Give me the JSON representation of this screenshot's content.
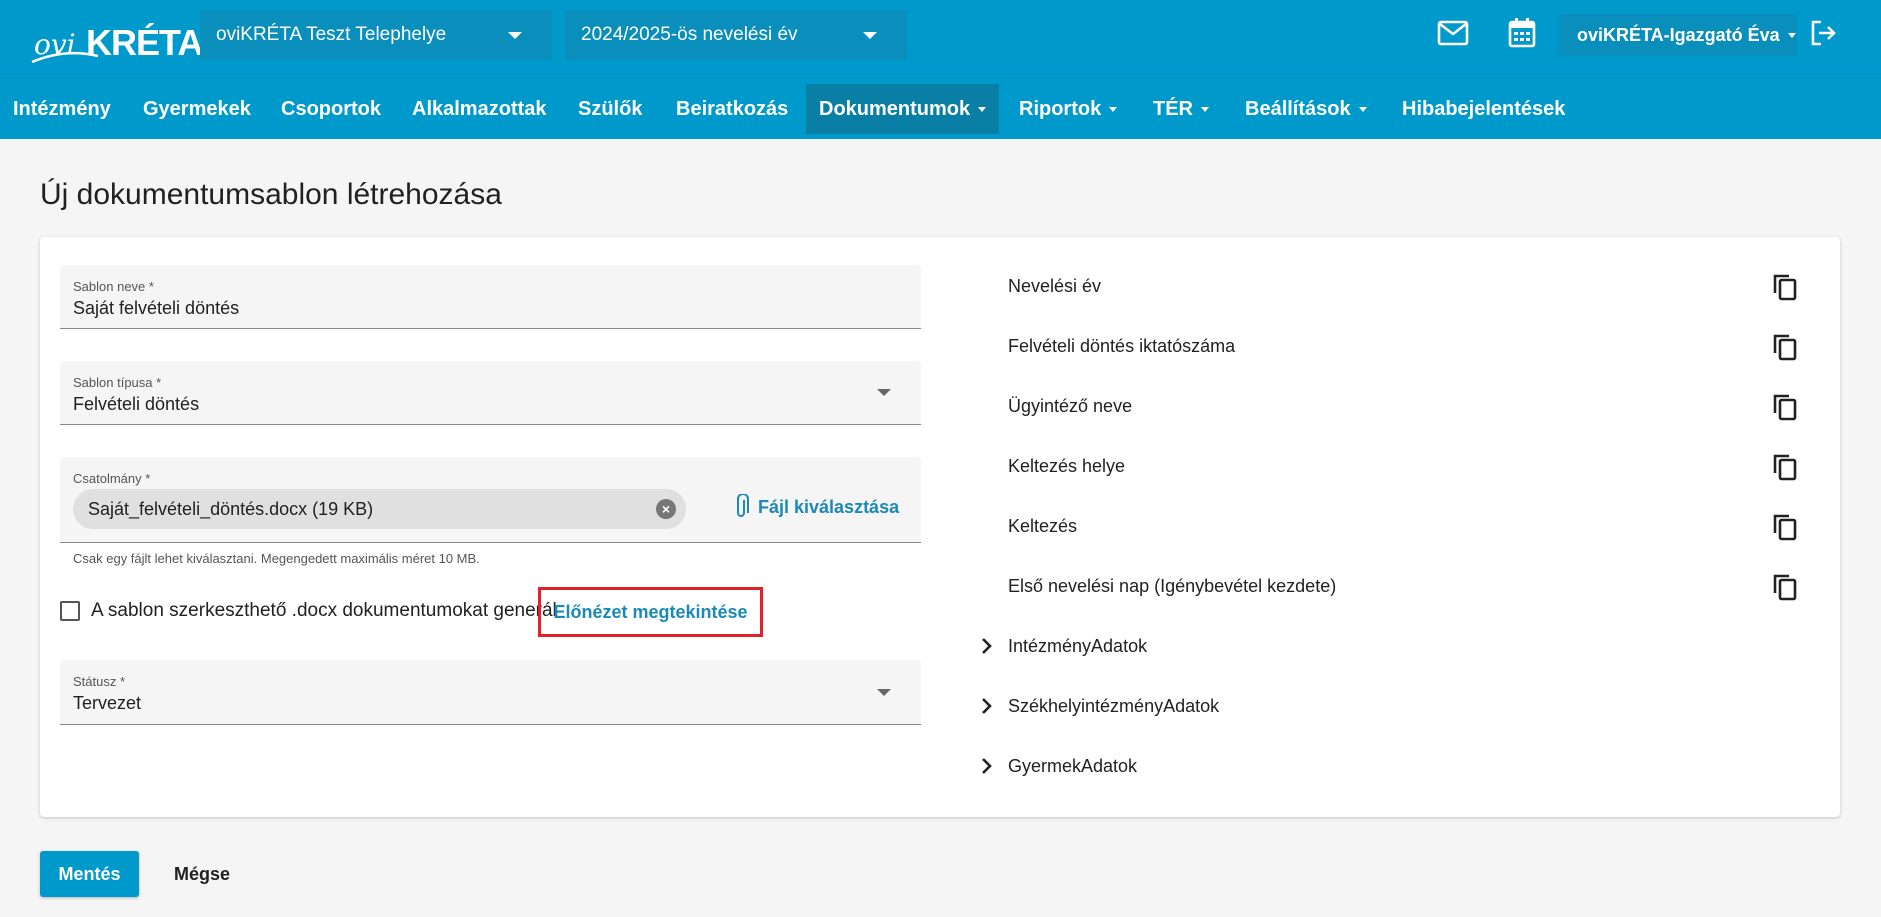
{
  "header": {
    "logo_ovi": "ovi",
    "logo_kreta": "KRÉTA",
    "site_select": "oviKRÉTA Teszt Telephelye",
    "year_select": "2024/2025-ös nevelési év",
    "user": "oviKRÉTA-Igazgató Éva"
  },
  "nav": {
    "items": [
      {
        "label": "Intézmény"
      },
      {
        "label": "Gyermekek"
      },
      {
        "label": "Csoportok"
      },
      {
        "label": "Alkalmazottak"
      },
      {
        "label": "Szülők"
      },
      {
        "label": "Beiratkozás"
      },
      {
        "label": "Dokumentumok"
      },
      {
        "label": "Riportok"
      },
      {
        "label": "TÉR"
      },
      {
        "label": "Beállítások"
      },
      {
        "label": "Hibabejelentések"
      }
    ],
    "active": "Dokumentumok"
  },
  "page": {
    "title": "Új dokumentumsablon létrehozása"
  },
  "form": {
    "name_label": "Sablon neve *",
    "name_value": "Saját felvételi döntés",
    "type_label": "Sablon típusa *",
    "type_value": "Felvételi döntés",
    "attachment_label": "Csatolmány *",
    "attachment_file": "Saját_felvételi_döntés.docx (19 KB)",
    "file_pick_label": "Fájl kiválasztása",
    "attachment_hint": "Csak egy fájlt lehet kiválasztani. Megengedett maximális méret 10 MB.",
    "editable_checkbox_label": "A sablon szerkeszthető .docx dokumentumokat generál",
    "preview_button": "Előnézet megtekintése",
    "status_label": "Státusz *",
    "status_value": "Tervezet"
  },
  "variables": [
    "Nevelési év",
    "Felvételi döntés iktatószáma",
    "Ügyintéző neve",
    "Keltezés helye",
    "Keltezés",
    "Első nevelési nap (Igénybevétel kezdete)"
  ],
  "groups": [
    "IntézményAdatok",
    "SzékhelyintézményAdatok",
    "GyermekAdatok"
  ],
  "actions": {
    "save": "Mentés",
    "cancel": "Mégse"
  },
  "colors": {
    "primary": "#0099cc",
    "link": "#1b8ab8",
    "highlight_border": "#e1222a"
  }
}
